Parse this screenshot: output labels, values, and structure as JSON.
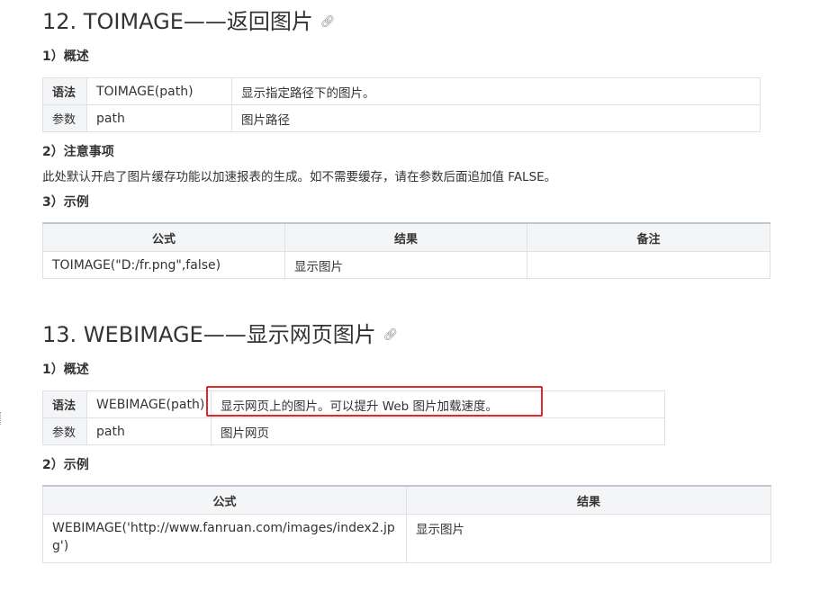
{
  "section12": {
    "title": "12. TOIMAGE——返回图片",
    "link_icon": "link-icon",
    "overview_heading": "1）概述",
    "def_rows": [
      {
        "key": "语法",
        "col1": "TOIMAGE(path)",
        "col2": "显示指定路径下的图片。"
      },
      {
        "key": "参数",
        "col1": "path",
        "col2": "图片路径"
      }
    ],
    "notes_heading": "2）注意事项",
    "notes_text": "此处默认开启了图片缓存功能以加速报表的生成。如不需要缓存，请在参数后面追加值 FALSE。",
    "example_heading": "3）示例",
    "example_headers": [
      "公式",
      "结果",
      "备注"
    ],
    "example_rows": [
      {
        "formula": "TOIMAGE(\"D:/fr.png\",false)",
        "result": "显示图片",
        "note": ""
      }
    ]
  },
  "section13": {
    "title": "13. WEBIMAGE——显示网页图片",
    "link_icon": "link-icon",
    "overview_heading": "1）概述",
    "def_rows": [
      {
        "key": "语法",
        "col1": "WEBIMAGE(path)",
        "col2": "显示网页上的图片。可以提升 Web 图片加载速度。"
      },
      {
        "key": "参数",
        "col1": "path",
        "col2": "图片网页"
      }
    ],
    "example_heading": "2）示例",
    "example_headers": [
      "公式",
      "结果"
    ],
    "example_rows": [
      {
        "formula": "WEBIMAGE('http://www.fanruan.com/images/index2.jpg')",
        "result": "显示图片"
      }
    ]
  },
  "colors": {
    "highlight_border": "#e5252a",
    "table_border": "#dfe1e6",
    "header_bg": "#f4f5f7",
    "text": "#333333"
  }
}
